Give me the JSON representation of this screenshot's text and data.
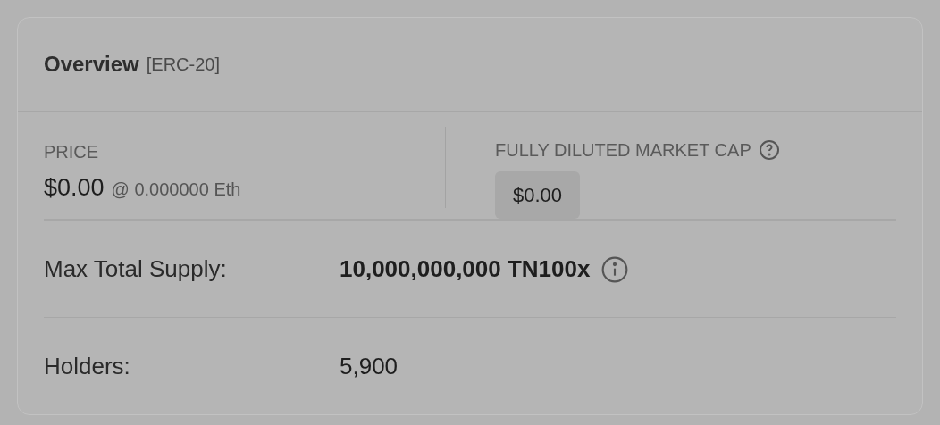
{
  "card": {
    "title": "Overview",
    "tag": "[ERC-20]"
  },
  "price": {
    "label": "PRICE",
    "value": "$0.00",
    "eth": "@ 0.000000 Eth"
  },
  "market_cap": {
    "label": "FULLY DILUTED MARKET CAP",
    "value": "$0.00"
  },
  "rows": [
    {
      "label": "Max Total Supply:",
      "value": "10,000,000,000 TN100x",
      "bold": true,
      "info": true
    },
    {
      "label": "Holders:",
      "value": "5,900",
      "bold": false,
      "info": false
    }
  ]
}
